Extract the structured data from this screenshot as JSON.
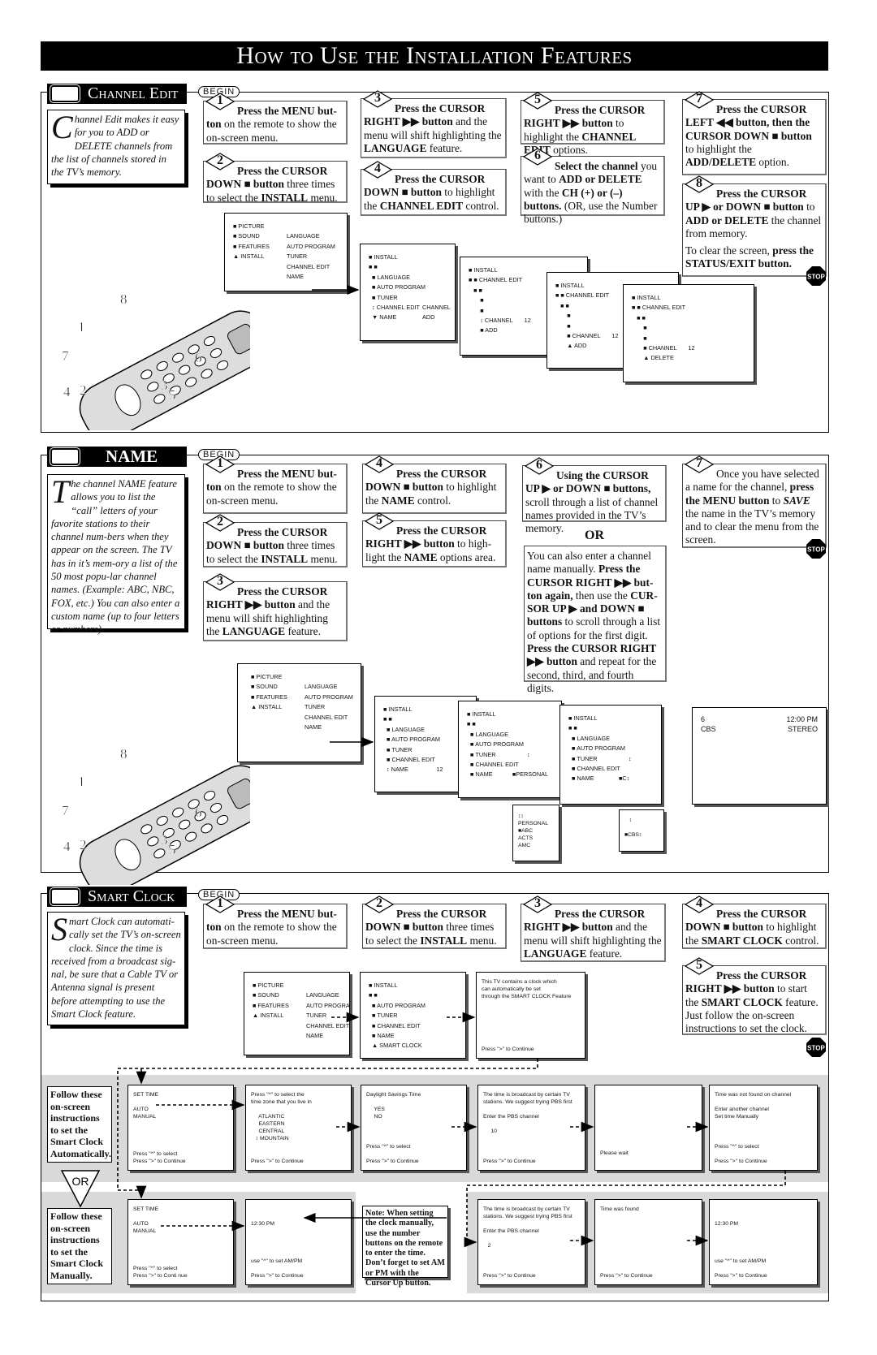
{
  "title": "How to Use the Installation Features",
  "begin_label": "BEGIN",
  "stop_label": "STOP",
  "channel_edit": {
    "heading": "Channel Edit",
    "intro_cap": "C",
    "intro": "hannel Edit makes it easy for you to ADD or DELETE channels from the list of channels stored in the TV’s memory.",
    "steps": [
      {
        "n": "1",
        "segs": [
          [
            "Press the MENU but-",
            "b"
          ],
          [
            "ton",
            "b"
          ],
          [
            " on the remote to show the on-screen menu.",
            ""
          ]
        ]
      },
      {
        "n": "2",
        "segs": [
          [
            "Press the CURSOR DOWN ■ button",
            "b"
          ],
          [
            " three times to select the ",
            ""
          ],
          [
            "INSTALL",
            "b"
          ],
          [
            " menu.",
            ""
          ]
        ]
      },
      {
        "n": "3",
        "segs": [
          [
            "Press the CURSOR RIGHT ▶▶ button",
            "b"
          ],
          [
            " and the menu will shift highlighting the ",
            ""
          ],
          [
            "LANGUAGE",
            "b"
          ],
          [
            " feature.",
            ""
          ]
        ]
      },
      {
        "n": "4",
        "segs": [
          [
            "Press the CURSOR DOWN ■ button",
            "b"
          ],
          [
            " to highlight the ",
            ""
          ],
          [
            "CHANNEL EDIT",
            "b"
          ],
          [
            " control.",
            ""
          ]
        ]
      },
      {
        "n": "5",
        "segs": [
          [
            "Press the CURSOR RIGHT ▶▶ button",
            "b"
          ],
          [
            " to highlight the ",
            ""
          ],
          [
            "CHANNEL EDIT",
            "b"
          ],
          [
            " options.",
            ""
          ]
        ]
      },
      {
        "n": "6",
        "segs": [
          [
            "Select the channel",
            "b"
          ],
          [
            " you want to ",
            ""
          ],
          [
            "ADD or DELETE",
            "b"
          ],
          [
            " with the ",
            ""
          ],
          [
            "CH (+) or (–) buttons.",
            "b"
          ],
          [
            " (OR, use the Number buttons.)",
            ""
          ]
        ]
      },
      {
        "n": "7",
        "segs": [
          [
            "Press the CURSOR LEFT ◀◀ button, then the CURSOR DOWN ■ button",
            "b"
          ],
          [
            " to highlight the ",
            ""
          ],
          [
            "ADD/DELETE",
            "b"
          ],
          [
            " option.",
            ""
          ]
        ]
      },
      {
        "n": "8",
        "segs": [
          [
            "Press the CURSOR UP ▶ or DOWN ■ button",
            "b"
          ],
          [
            " to ",
            ""
          ],
          [
            "ADD or DELETE",
            "b"
          ],
          [
            " the channel from memory.",
            ""
          ]
        ],
        "extra": [
          [
            "To clear the screen, ",
            ""
          ],
          [
            "press the STATUS/EXIT button.",
            "b"
          ]
        ]
      }
    ],
    "screens": [
      [
        [
          "■ PICTURE",
          ""
        ],
        [
          "■ SOUND",
          "LANGUAGE"
        ],
        [
          "■ FEATURES",
          "AUTO PROGRAM"
        ],
        [
          "▲ INSTALL",
          "TUNER"
        ],
        [
          "",
          "CHANNEL EDIT"
        ],
        [
          "",
          "NAME"
        ]
      ],
      [
        [
          "■ INSTALL",
          ""
        ],
        [
          "■ ■",
          ""
        ],
        [
          "  ■ LANGUAGE",
          ""
        ],
        [
          "  ■ AUTO PROGRAM",
          ""
        ],
        [
          "  ■ TUNER",
          ""
        ],
        [
          "  ↕ CHANNEL EDIT",
          "CHANNEL"
        ],
        [
          "  ▼ NAME",
          "ADD"
        ]
      ],
      [
        [
          "■ INSTALL",
          ""
        ],
        [
          "■ ■ CHANNEL EDIT",
          ""
        ],
        [
          "   ■ ■",
          ""
        ],
        [
          "       ■",
          ""
        ],
        [
          "       ■",
          ""
        ],
        [
          "       ↕ CHANNEL       12",
          ""
        ],
        [
          "       ■ ADD",
          ""
        ]
      ],
      [
        [
          "■ INSTALL",
          ""
        ],
        [
          "■ ■ CHANNEL EDIT",
          ""
        ],
        [
          "   ■ ■",
          ""
        ],
        [
          "       ■",
          ""
        ],
        [
          "       ■",
          ""
        ],
        [
          "       ■ CHANNEL       12",
          ""
        ],
        [
          "       ▲ ADD",
          ""
        ]
      ],
      [
        [
          "■ INSTALL",
          ""
        ],
        [
          "■ ■ CHANNEL EDIT",
          ""
        ],
        [
          "   ■ ■",
          ""
        ],
        [
          "       ■",
          ""
        ],
        [
          "       ■",
          ""
        ],
        [
          "       ■ CHANNEL       12",
          ""
        ],
        [
          "       ▲ DELETE",
          ""
        ]
      ]
    ],
    "remote_numbers": [
      "1",
      "2",
      "3",
      "4",
      "5",
      "6",
      "7",
      "8"
    ]
  },
  "name": {
    "heading": "NAME",
    "intro_cap": "T",
    "intro": "he channel NAME feature allows you to list the “call” letters of your favorite stations to their channel num-bers when they appear on the screen. The TV has in it’s mem-ory a list of the 50 most popu-lar channel names. (Example: ABC, NBC, FOX, etc.) You can also enter a custom name (up to four  letters or numbers).",
    "steps": [
      {
        "n": "1",
        "segs": [
          [
            "Press the MENU but-ton",
            "b"
          ],
          [
            " on the remote to show the on-screen menu.",
            ""
          ]
        ]
      },
      {
        "n": "2",
        "segs": [
          [
            "Press the CURSOR DOWN ■ button",
            "b"
          ],
          [
            " three times to select the ",
            ""
          ],
          [
            "INSTALL",
            "b"
          ],
          [
            " menu.",
            ""
          ]
        ]
      },
      {
        "n": "3",
        "segs": [
          [
            "Press the CURSOR RIGHT ▶▶ button",
            "b"
          ],
          [
            " and the menu will shift highlighting the ",
            ""
          ],
          [
            "LANGUAGE",
            "b"
          ],
          [
            " feature.",
            ""
          ]
        ]
      },
      {
        "n": "4",
        "segs": [
          [
            "Press the CURSOR DOWN ■ button",
            "b"
          ],
          [
            " to highlight the ",
            ""
          ],
          [
            "NAME",
            "b"
          ],
          [
            " control.",
            ""
          ]
        ]
      },
      {
        "n": "5",
        "segs": [
          [
            "Press the CURSOR RIGHT ▶▶ button",
            "b"
          ],
          [
            " to high-light the ",
            ""
          ],
          [
            "NAME",
            "b"
          ],
          [
            " options area.",
            ""
          ]
        ]
      },
      {
        "n": "6",
        "segs": [
          [
            "Using the CURSOR UP ▶ or DOWN ■ buttons,",
            "b"
          ],
          [
            " scroll through a list of channel names provided in the TV’s memory.",
            ""
          ]
        ]
      },
      {
        "n": "7",
        "segs": [
          [
            "Once you have selected a name for the channel, ",
            ""
          ],
          [
            "press the MENU button",
            "b"
          ],
          [
            " to ",
            ""
          ],
          [
            "SAVE",
            "bi"
          ],
          [
            " the name in the TV’s memory and to clear the menu from the screen.",
            ""
          ]
        ]
      }
    ],
    "or_label": "OR",
    "or_text": [
      [
        "You can also enter a channel name manually. ",
        ""
      ],
      [
        "Press the CURSOR RIGHT ▶▶ but-ton again,",
        "b"
      ],
      [
        " then use the ",
        ""
      ],
      [
        "CUR-SOR UP ▶ and DOWN ■ buttons",
        "b"
      ],
      [
        " to scroll through a list of options for the first digit. ",
        ""
      ],
      [
        "Press the CURSOR RIGHT ▶▶ button",
        "b"
      ],
      [
        " and repeat for the second, third, and fourth digits.",
        ""
      ]
    ],
    "screens": [
      [
        [
          "■ PICTURE",
          ""
        ],
        [
          "■ SOUND",
          "LANGUAGE"
        ],
        [
          "■ FEATURES",
          "AUTO PROGRAM"
        ],
        [
          "▲ INSTALL",
          "TUNER"
        ],
        [
          "",
          "CHANNEL EDIT"
        ],
        [
          "",
          "NAME"
        ]
      ],
      [
        [
          "■ INSTALL",
          ""
        ],
        [
          "■ ■",
          ""
        ],
        [
          "  ■ LANGUAGE",
          ""
        ],
        [
          "  ■ AUTO PROGRAM",
          ""
        ],
        [
          "  ■ TUNER",
          ""
        ],
        [
          "  ■ CHANNEL EDIT",
          ""
        ],
        [
          "  ↕ NAME                 12",
          ""
        ]
      ],
      [
        [
          "■ INSTALL",
          ""
        ],
        [
          "■ ■",
          ""
        ],
        [
          "  ■ LANGUAGE",
          ""
        ],
        [
          "  ■ AUTO PROGRAM",
          ""
        ],
        [
          "  ■ TUNER                   ↕",
          ""
        ],
        [
          "  ■ CHANNEL EDIT",
          ""
        ],
        [
          "  ■ NAME            ■PERSONAL",
          ""
        ]
      ],
      [
        [
          "■ INSTALL",
          ""
        ],
        [
          "■ ■",
          ""
        ],
        [
          "  ■ LANGUAGE",
          ""
        ],
        [
          "  ■ AUTO PROGRAM",
          ""
        ],
        [
          "  ■ TUNER                   ↕",
          ""
        ],
        [
          "  ■ CHANNEL EDIT",
          ""
        ],
        [
          "  ■ NAME               ■C↕",
          ""
        ]
      ]
    ],
    "popup1": [
      [
        "↕↕",
        ""
      ],
      [
        "PERSONAL",
        ""
      ],
      [
        "■ABC",
        ""
      ],
      [
        "ACTS",
        ""
      ],
      [
        "AMC",
        ""
      ]
    ],
    "popup2": [
      [
        "   ↕",
        ""
      ],
      [
        "",
        ""
      ],
      [
        "■CBS↕",
        ""
      ]
    ],
    "tv": {
      "channel": "6",
      "time": "12:00 PM",
      "station": "CBS",
      "audio": "STEREO"
    },
    "remote_numbers": [
      "1",
      "2",
      "3",
      "4",
      "5",
      "6",
      "7",
      "8"
    ]
  },
  "smart_clock": {
    "heading": "Smart Clock",
    "intro_cap": "S",
    "intro": "mart Clock can automati-cally set the TV’s on-screen clock. Since the time is received from a broadcast sig-nal, be sure that a Cable TV or Antenna signal is present before attempting to use the Smart Clock feature.",
    "steps": [
      {
        "n": "1",
        "segs": [
          [
            "Press the MENU but-ton",
            "b"
          ],
          [
            " on the remote to show the on-screen menu.",
            ""
          ]
        ]
      },
      {
        "n": "2",
        "segs": [
          [
            "Press the CURSOR DOWN ■ button",
            "b"
          ],
          [
            " three times to select the ",
            ""
          ],
          [
            "INSTALL",
            "b"
          ],
          [
            " menu.",
            ""
          ]
        ]
      },
      {
        "n": "3",
        "segs": [
          [
            "Press the CURSOR RIGHT ▶▶ button",
            "b"
          ],
          [
            " and the menu will shift highlighting the ",
            ""
          ],
          [
            "LANGUAGE",
            "b"
          ],
          [
            " feature.",
            ""
          ]
        ]
      },
      {
        "n": "4",
        "segs": [
          [
            "Press the CURSOR DOWN ■ button",
            "b"
          ],
          [
            " to highlight the ",
            ""
          ],
          [
            "SMART CLOCK",
            "b"
          ],
          [
            " control.",
            ""
          ]
        ]
      },
      {
        "n": "5",
        "segs": [
          [
            "Press the CURSOR RIGHT ▶▶ button",
            "b"
          ],
          [
            " to start the ",
            ""
          ],
          [
            "SMART CLOCK",
            "b"
          ],
          [
            " feature. Just follow the on-screen instructions to set the clock.",
            ""
          ]
        ]
      }
    ],
    "screens": [
      {
        "top": [
          [
            "■ PICTURE",
            ""
          ],
          [
            "■ SOUND",
            "LANGUAGE"
          ],
          [
            "■ FEATURES",
            "AUTO PROGRAM"
          ],
          [
            "▲ INSTALL",
            "TUNER"
          ],
          [
            "",
            "CHANNEL EDIT"
          ],
          [
            "",
            "NAME"
          ]
        ],
        "bottom": []
      },
      {
        "top": [
          [
            "■ INSTALL",
            ""
          ],
          [
            "■ ■",
            ""
          ],
          [
            "  ■ AUTO PROGRAM",
            ""
          ],
          [
            "  ■ TUNER",
            ""
          ],
          [
            "  ■ CHANNEL EDIT",
            ""
          ],
          [
            "  ■ NAME",
            ""
          ],
          [
            "  ▲ SMART CLOCK",
            ""
          ]
        ],
        "bottom": []
      },
      {
        "top": [
          [
            "This TV contains a clock which",
            ""
          ],
          [
            "can automatically be set",
            ""
          ],
          [
            "through the SMART CLOCK Feature",
            ""
          ]
        ],
        "bottom": [
          [
            "Press \">\" to Continue",
            ""
          ]
        ]
      }
    ],
    "follow_auto": "Follow these on-screen instructions to set the Smart Clock Automatically.",
    "follow_manual": "Follow these on-screen instructions to set the Smart Clock Manually.",
    "or_label": "OR",
    "auto_screens": [
      {
        "top": [
          "SET TIME",
          "",
          "AUTO",
          "MANUAL"
        ],
        "bottom": [
          "Press \"^\" to select",
          "Press \">\" to Continue"
        ]
      },
      {
        "top": [
          "Press \"^\" to select the",
          "time zone that you live in",
          "",
          "     ATLANTIC",
          "     EASTERN",
          "     CENTRAL",
          "   ↕ MOUNTAIN"
        ],
        "bottom": [
          "Press \">\" to Continue"
        ]
      },
      {
        "top": [
          "Daylight Savings Time",
          "",
          "     YES",
          "     NO"
        ],
        "bottom": [
          "Press \"^\" to select",
          "",
          "Press \">\" to Continue"
        ]
      },
      {
        "top": [
          "The time is broadcast by certain TV",
          "stations. We suggest trying PBS first",
          "",
          "Enter the PBS channel",
          "",
          "     10"
        ],
        "bottom": [
          "Press \">\" to Continue"
        ]
      },
      {
        "top": [
          "",
          "",
          "",
          "",
          "",
          "",
          "",
          "",
          "Please wait"
        ],
        "bottom": []
      },
      {
        "top": [
          "Time was not found on channel",
          "",
          "Enter another channel",
          "Set time Manually"
        ],
        "bottom": [
          "Press \"^\" to select",
          "",
          "Press \">\" to Continue"
        ]
      }
    ],
    "manual_screens": [
      {
        "top": [
          "SET TIME",
          "",
          "AUTO",
          "MANUAL"
        ],
        "bottom": [
          "Press \"^\" to select",
          "Press \">\" to Conti nue"
        ]
      },
      {
        "top": [
          "",
          "",
          "12:30 PM"
        ],
        "bottom": [
          "use \"^\" to set AM/PM",
          "",
          "Press \">\" to Continue"
        ]
      },
      {
        "top": [
          "The time is broadcast by certain TV",
          "stations. We suggest trying PBS first",
          "",
          "Enter the PBS channel",
          "",
          "   2"
        ],
        "bottom": [
          "Press \">\" to Continue"
        ]
      },
      {
        "top": [
          "Time was found"
        ],
        "bottom": [
          "Press \">\" to Continue"
        ]
      },
      {
        "top": [
          "",
          "",
          "12:30 PM"
        ],
        "bottom": [
          "use \"^\" to set AM/PM",
          "",
          "Press \">\" to Continue"
        ]
      }
    ],
    "note": "Note: When setting the clock manually, use the number buttons on the remote to enter the time. Don’t forget to set AM or PM with the Cursor Up button."
  }
}
